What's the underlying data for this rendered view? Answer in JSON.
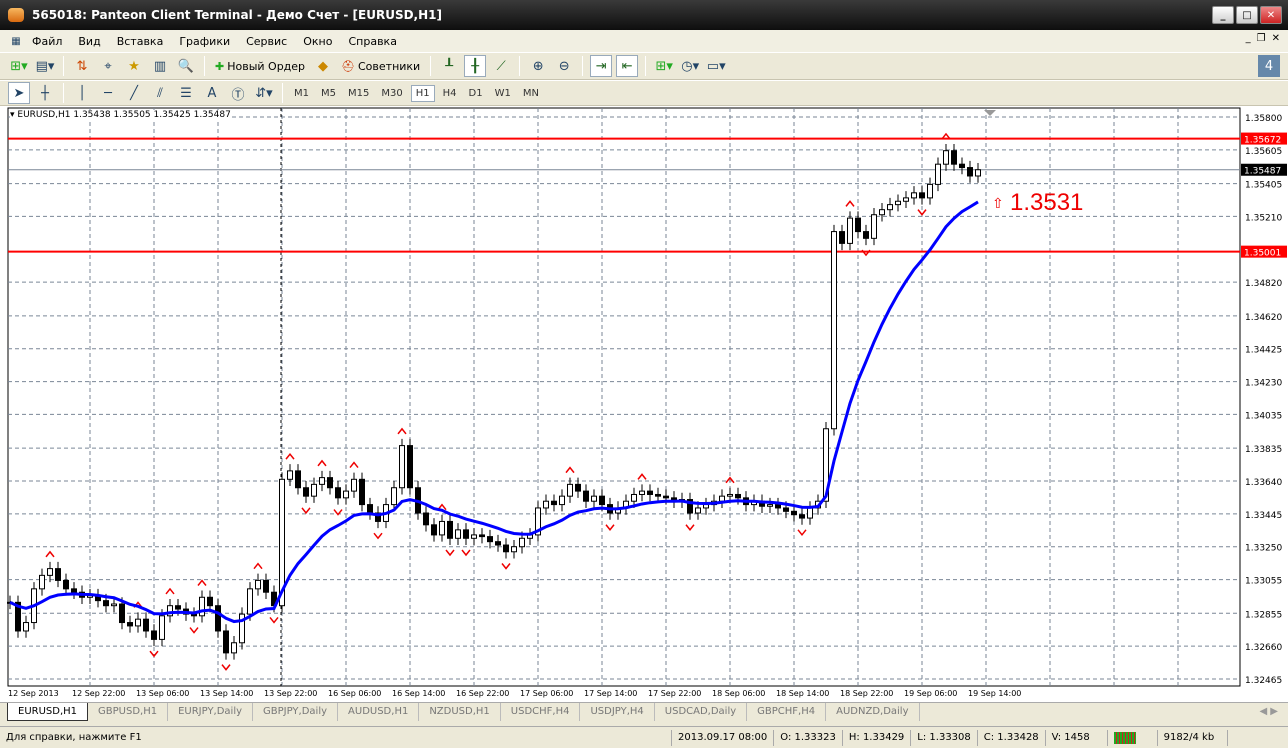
{
  "window": {
    "title": "565018: Panteon Client Terminal - Демо Счет - [EURUSD,H1]"
  },
  "menu": [
    "Файл",
    "Вид",
    "Вставка",
    "Графики",
    "Сервис",
    "Окно",
    "Справка"
  ],
  "toolbar": {
    "new_order": "Новый Ордер",
    "experts": "Советники"
  },
  "drawing_tools": {
    "text_tool": "A"
  },
  "timeframes": [
    "M1",
    "M5",
    "M15",
    "M30",
    "H1",
    "H4",
    "D1",
    "W1",
    "MN"
  ],
  "active_timeframe": "H1",
  "chart": {
    "legend": "EURUSD,H1  1.35438 1.35505 1.35425 1.35487",
    "ma_label": "1.3531",
    "up_arrow": "⇧"
  },
  "chart_data": {
    "type": "candlestick",
    "symbol": "EURUSD",
    "timeframe": "H1",
    "price_ticks": [
      "1.35800",
      "1.35605",
      "1.35405",
      "1.35210",
      "1.34820",
      "1.34620",
      "1.34425",
      "1.34230",
      "1.34035",
      "1.33835",
      "1.33640",
      "1.33445",
      "1.33250",
      "1.33055",
      "1.32855",
      "1.32660",
      "1.32465"
    ],
    "time_labels": [
      "12 Sep 2013",
      "12 Sep 22:00",
      "13 Sep 06:00",
      "13 Sep 14:00",
      "13 Sep 22:00",
      "16 Sep 06:00",
      "16 Sep 14:00",
      "16 Sep 22:00",
      "17 Sep 06:00",
      "17 Sep 14:00",
      "17 Sep 22:00",
      "18 Sep 06:00",
      "18 Sep 14:00",
      "18 Sep 22:00",
      "19 Sep 06:00",
      "19 Sep 14:00"
    ],
    "ylim": [
      1.32465,
      1.358
    ],
    "closes": [
      1.3292,
      1.3275,
      1.328,
      1.33,
      1.3308,
      1.3312,
      1.3305,
      1.33,
      1.3298,
      1.3295,
      1.3296,
      1.3293,
      1.329,
      1.3291,
      1.328,
      1.3278,
      1.3282,
      1.3275,
      1.327,
      1.3284,
      1.329,
      1.3288,
      1.3285,
      1.3284,
      1.3295,
      1.329,
      1.3275,
      1.3262,
      1.3268,
      1.3285,
      1.33,
      1.3305,
      1.3298,
      1.329,
      1.3365,
      1.337,
      1.336,
      1.3355,
      1.3362,
      1.3366,
      1.336,
      1.3354,
      1.3358,
      1.3365,
      1.335,
      1.3345,
      1.334,
      1.335,
      1.336,
      1.3385,
      1.336,
      1.3345,
      1.3338,
      1.3332,
      1.334,
      1.333,
      1.3335,
      1.333,
      1.3332,
      1.3331,
      1.3328,
      1.3326,
      1.3322,
      1.3325,
      1.333,
      1.3332,
      1.3348,
      1.3352,
      1.335,
      1.3355,
      1.3362,
      1.3358,
      1.3352,
      1.3355,
      1.335,
      1.3345,
      1.3348,
      1.3352,
      1.3356,
      1.3358,
      1.3356,
      1.3355,
      1.3354,
      1.3352,
      1.3353,
      1.3345,
      1.3348,
      1.335,
      1.3352,
      1.3355,
      1.3356,
      1.3354,
      1.335,
      1.3352,
      1.3349,
      1.335,
      1.3348,
      1.3346,
      1.3344,
      1.3342,
      1.3348,
      1.3352,
      1.3395,
      1.3512,
      1.3505,
      1.352,
      1.3512,
      1.3508,
      1.3522,
      1.3525,
      1.3528,
      1.353,
      1.3532,
      1.3535,
      1.3532,
      1.354,
      1.3552,
      1.356,
      1.3552,
      1.355,
      1.3545,
      1.35487
    ],
    "hlines": [
      {
        "price": 1.35672,
        "label": "1.35672",
        "color": "#ff0000"
      },
      {
        "price": 1.35001,
        "label": "1.35001",
        "color": "#ff0000"
      }
    ],
    "bid": {
      "price": 1.35487,
      "label": "1.35487"
    },
    "ma_color": "#0000ff"
  },
  "tabs": [
    "EURUSD,H1",
    "GBPUSD,H1",
    "EURJPY,Daily",
    "GBPJPY,Daily",
    "AUDUSD,H1",
    "NZDUSD,H1",
    "USDCHF,H4",
    "USDJPY,H4",
    "USDCAD,Daily",
    "GBPCHF,H4",
    "AUDNZD,Daily"
  ],
  "status": {
    "help": "Для справки, нажмите F1",
    "time": "2013.09.17 08:00",
    "open": "O: 1.33323",
    "high": "H: 1.33429",
    "low": "L: 1.33308",
    "close": "C: 1.33428",
    "volume": "V: 1458",
    "traffic": "9182/4 kb"
  }
}
